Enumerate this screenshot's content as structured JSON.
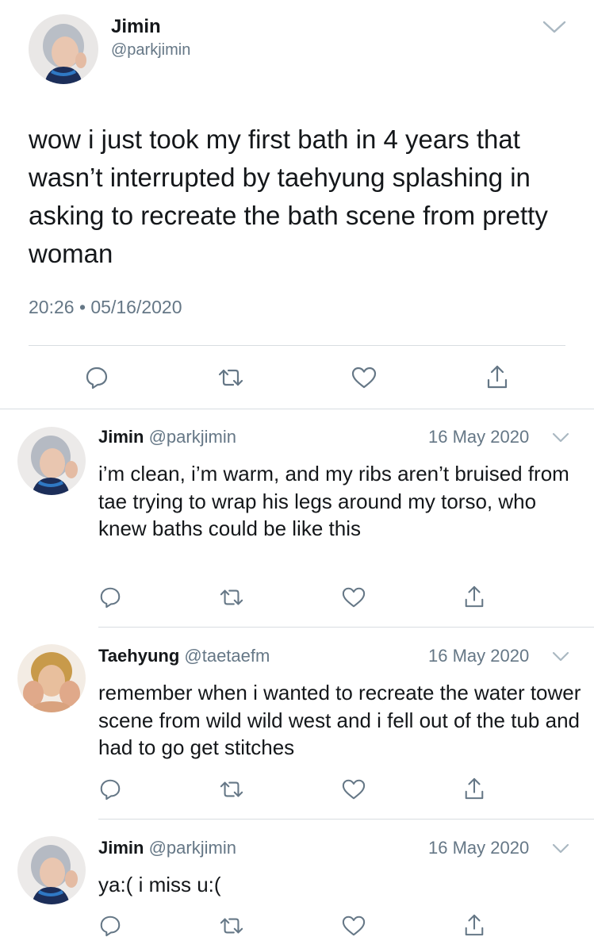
{
  "main_tweet": {
    "display_name": "Jimin",
    "handle": "@parkjimin",
    "text": "wow i just took my first bath in 4 years that wasn’t interrupted by taehyung splashing in asking to recreate the bath scene from pretty woman",
    "timestamp": "20:26 • 05/16/2020"
  },
  "replies": [
    {
      "display_name": "Jimin",
      "handle": "@parkjimin",
      "date": "16 May 2020",
      "text": "i’m clean, i’m warm, and my ribs aren’t bruised from tae trying to wrap his legs around my torso, who knew baths could be like this"
    },
    {
      "display_name": "Taehyung",
      "handle": "@taetaefm",
      "date": "16 May 2020",
      "text": "remember when i wanted to recreate the water tower scene from wild wild west and i fell out of the tub and had to go get stitches"
    },
    {
      "display_name": "Jimin",
      "handle": "@parkjimin",
      "date": "16 May 2020",
      "text": "ya:( i miss u:("
    }
  ],
  "icons": {
    "reply": "reply-icon",
    "retweet": "retweet-icon",
    "like": "like-icon",
    "share": "share-icon",
    "menu": "chevron-down-icon"
  },
  "colors": {
    "text": "#14171a",
    "muted": "#657786",
    "divider": "#d8dde1"
  }
}
